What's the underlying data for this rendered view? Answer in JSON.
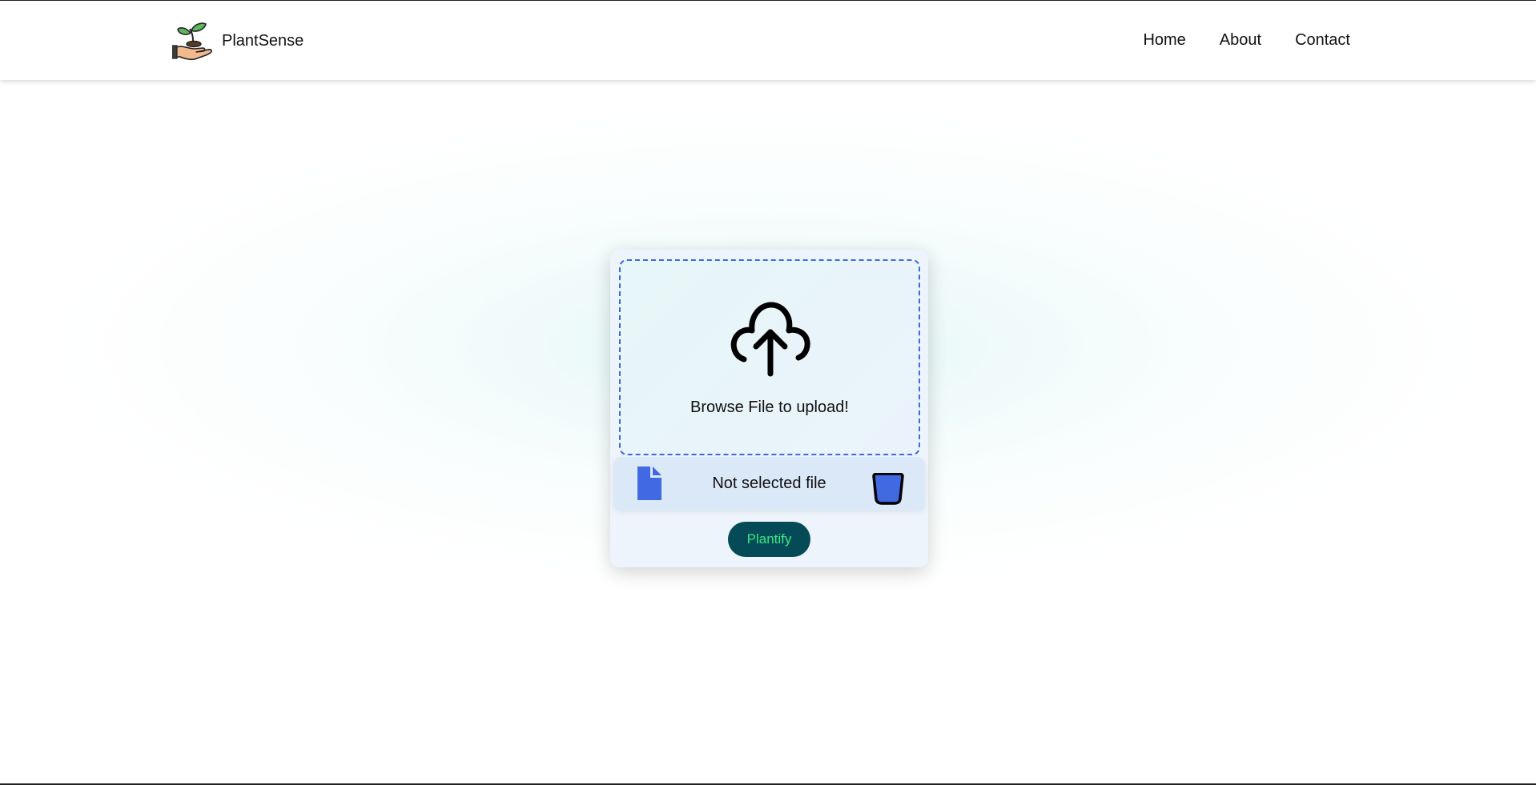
{
  "navbar": {
    "brand_name": "PlantSense",
    "brand_logo_icon": "hand-holding-sprout-icon",
    "links": [
      {
        "label": "Home"
      },
      {
        "label": "About"
      },
      {
        "label": "Contact"
      }
    ]
  },
  "upload": {
    "upload_icon": "cloud-upload-icon",
    "drop_label": "Browse File to upload!",
    "file_icon": "file-icon",
    "file_status": "Not selected file",
    "delete_icon": "trash-icon",
    "submit_label": "Plantify"
  },
  "colors": {
    "accent_blue": "#4169e1",
    "button_bg": "#054b57",
    "button_text": "#3ce883",
    "card_bg": "#eef4fb"
  }
}
